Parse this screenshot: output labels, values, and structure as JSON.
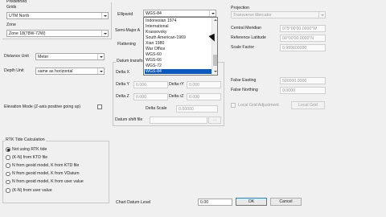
{
  "predefined": {
    "title": "Predefined",
    "grids_label": "Grids",
    "grids_value": "UTM North",
    "zone_label": "Zone",
    "zone_value": "Zone 18(78W-72W)"
  },
  "distance_unit": {
    "label": "Distance Unit",
    "value": "Meter"
  },
  "depth_unit": {
    "label": "Depth Unit",
    "value": "same as horizontal"
  },
  "elevation_mode": {
    "label": "Elevation Mode (Z-axis positive going up)",
    "checked": false
  },
  "ellipsoid": {
    "label": "Ellipsoid",
    "value": "WGS-84",
    "options": [
      "Indonesian 1974",
      "International",
      "Krassovsky",
      "South American-1969",
      "Xian 1980",
      "War Office",
      "WGS-60",
      "WGS-66",
      "WGS-72",
      "WGS-84"
    ],
    "selected": "WGS-84"
  },
  "semi_major_label": "Semi-Major A",
  "flattening_label": "Flattening",
  "datum": {
    "title": "Datum transfo",
    "delta_x_label": "Delta X",
    "delta_y_label": "Delta Y",
    "delta_y_value": "0.000",
    "delta_z_label": "Delta Z",
    "delta_z_value": "0.000",
    "delta_ry_label": "Delta rY",
    "delta_ry_value": "0.000",
    "delta_rz_label": "Delta rZ",
    "delta_rz_value": "0.000",
    "delta_scale_label": "Delta Scale",
    "delta_scale_value": "0.00000",
    "shift_file_label": "Datum shift file",
    "browse_label": "..."
  },
  "projection": {
    "label": "Projection",
    "value": "Transverse Mercator",
    "central_meridian_label": "Central Meridian",
    "central_meridian_value": "075°00'00.0000\"W",
    "reference_latitude_label": "Reference Latitude",
    "reference_latitude_value": "00°00'00.0000\"N",
    "scale_factor_label": "Scale Factor",
    "scale_factor_value": "0.999600000",
    "false_easting_label": "False Easting",
    "false_easting_value": "500000.0000",
    "false_northing_label": "False Northing",
    "false_northing_value": "0.0000",
    "local_grid_adjustment_label": "Local Grid Adjustment",
    "local_grid_button": "Local Grid"
  },
  "rtk": {
    "title": "RTK Tide Calculation",
    "options": [
      "Not using RTK tide",
      "(K-N) from KTD file",
      "N from geoid model, K from KTD file",
      "N from geoid model, K from VDatum",
      "N from geoid model, K from user value",
      "(K-N) from user value"
    ],
    "selected_index": 0
  },
  "chart_datum": {
    "label": "Chart Datum Level",
    "value": "0.00"
  },
  "buttons": {
    "ok": "OK",
    "cancel": "Cancel"
  },
  "icons": {
    "combo_arrow": "chevron-down-icon",
    "cursor": "mouse-pointer-icon"
  }
}
